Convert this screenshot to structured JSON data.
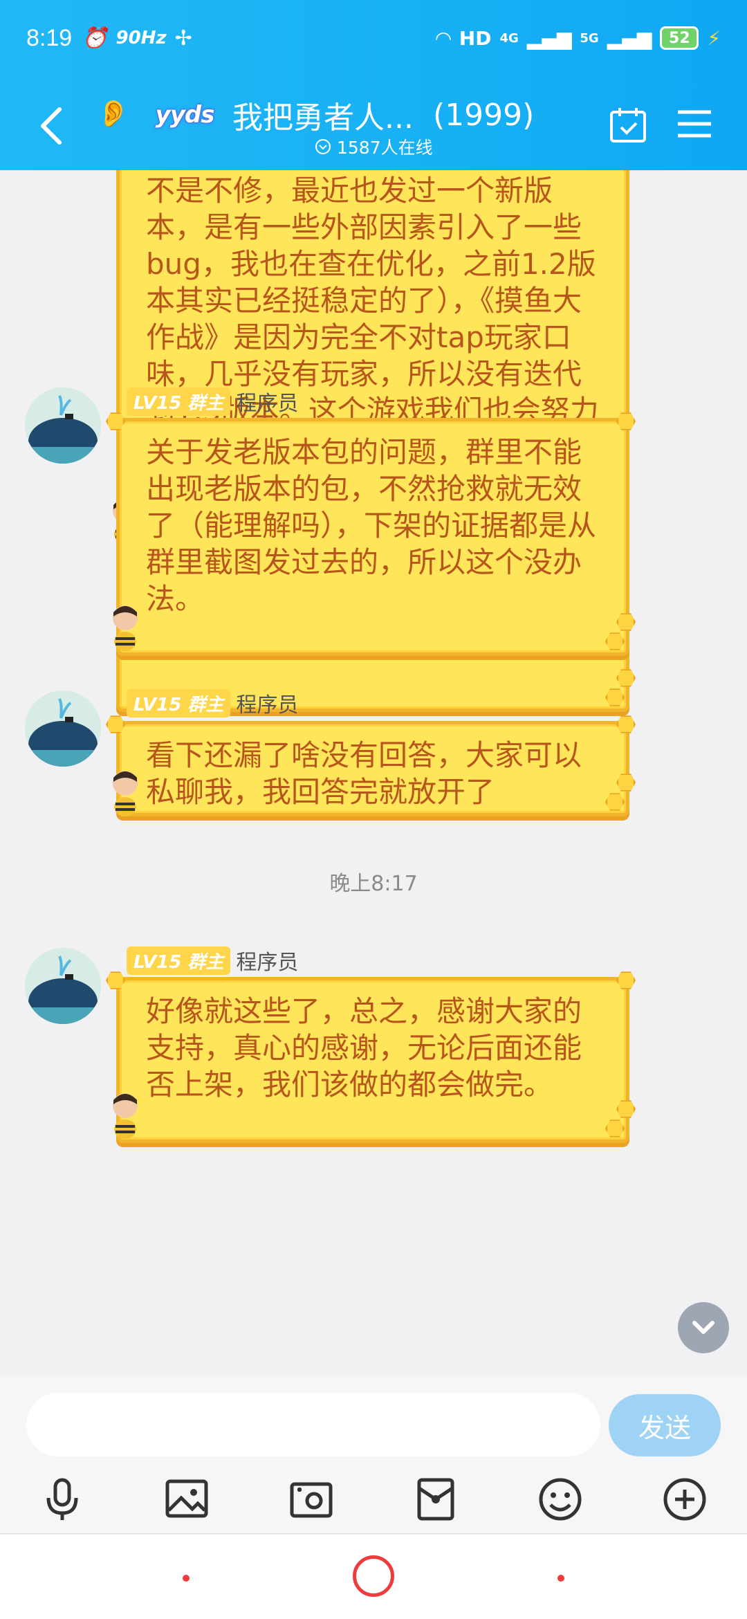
{
  "status_bar": {
    "time": "8:19",
    "refresh": "90Hz",
    "network": "HD",
    "net_4g": "4G",
    "net_5g": "5G",
    "battery": "52"
  },
  "header": {
    "logo_text": "yyds",
    "title": "我把勇者人...",
    "member_count": "(1999)",
    "online": "1587人在线"
  },
  "messages": [
    {
      "text": "不是不修，最近也发过一个新版本，是有一些外部因素引入了一些bug，我也在查在优化，之前1.2版本其实已经挺稳定的了），《摸鱼大作战》是因为完全不对tap玩家口味，几乎没有玩家，所以没有迭代到1.3版本。这个游戏我们也会努力迭代下去，故事包已经在做了，我需求单上bug单上的东西也会尽快做出来。"
    },
    {
      "level": "LV15",
      "rank": "群主",
      "role": "程序员",
      "text": "关于发老版本包的问题，群里不能出现老版本的包，不然抢救就无效了（能理解吗），下架的证据都是从群里截图发过去的，所以这个没办法。"
    },
    {
      "level": "LV15",
      "rank": "群主",
      "role": "程序员",
      "text": "看下还漏了啥没有回答，大家可以私聊我，我回答完就放开了"
    },
    {
      "level": "LV15",
      "rank": "群主",
      "role": "程序员",
      "text": "好像就这些了，总之，感谢大家的支持，真心的感谢，无论后面还能否上架，我们该做的都会做完。"
    }
  ],
  "timestamp": "晚上8:17",
  "input": {
    "value": "",
    "placeholder": ""
  },
  "send_label": "发送",
  "toolbar_icons": [
    "microphone-icon",
    "image-icon",
    "camera-icon",
    "red-packet-icon",
    "emoji-icon",
    "plus-icon"
  ],
  "colors": {
    "header": "#17b0f4",
    "bubble": "#ffe55a",
    "bubble_text": "#b7561a",
    "badge": "#ffd54a"
  }
}
